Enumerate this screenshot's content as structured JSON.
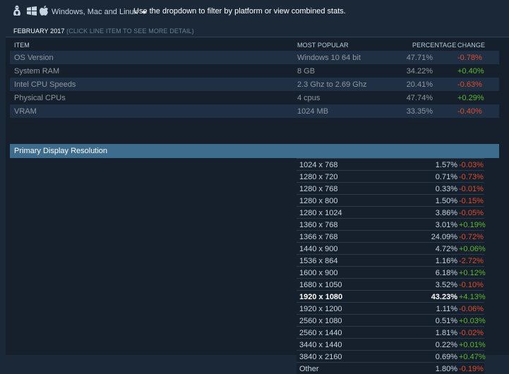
{
  "platform": {
    "icons": [
      "linux-icon",
      "windows-icon",
      "apple-icon"
    ],
    "selected": "Windows, Mac and Linux",
    "hint": "Use the dropdown to filter by platform or view combined stats."
  },
  "panel": {
    "title": "FEBRUARY 2017",
    "subtitle": "(CLICK LINE ITEM TO SEE MORE DETAIL)"
  },
  "columns": {
    "item": "ITEM",
    "popular": "MOST POPULAR",
    "percentage": "PERCENTAGE",
    "change": "CHANGE"
  },
  "rows": [
    {
      "item": "OS Version",
      "popular": "Windows 10 64 bit",
      "percentage": "47.71%",
      "change": "-0.78%",
      "trend": "neg"
    },
    {
      "item": "System RAM",
      "popular": "8 GB",
      "percentage": "34.22%",
      "change": "+0.40%",
      "trend": "pos"
    },
    {
      "item": "Intel CPU Speeds",
      "popular": "2.3 Ghz to 2.69 Ghz",
      "percentage": "20.41%",
      "change": "-0.63%",
      "trend": "neg"
    },
    {
      "item": "Physical CPUs",
      "popular": "4 cpus",
      "percentage": "47.74%",
      "change": "+0.29%",
      "trend": "pos"
    },
    {
      "item": "VRAM",
      "popular": "1024 MB",
      "percentage": "33.35%",
      "change": "-0.40%",
      "trend": "neg"
    }
  ],
  "section": {
    "label": "Primary Display Resolution",
    "items": [
      {
        "label": "1024 x 768",
        "percentage": "1.57%",
        "change": "-0.03%",
        "trend": "neg"
      },
      {
        "label": "1280 x 720",
        "percentage": "0.71%",
        "change": "-0.73%",
        "trend": "neg"
      },
      {
        "label": "1280 x 768",
        "percentage": "0.33%",
        "change": "-0.01%",
        "trend": "neg"
      },
      {
        "label": "1280 x 800",
        "percentage": "1.50%",
        "change": "-0.15%",
        "trend": "neg"
      },
      {
        "label": "1280 x 1024",
        "percentage": "3.86%",
        "change": "-0.05%",
        "trend": "neg"
      },
      {
        "label": "1360 x 768",
        "percentage": "3.01%",
        "change": "+0.19%",
        "trend": "pos"
      },
      {
        "label": "1366 x 768",
        "percentage": "24.09%",
        "change": "-0.72%",
        "trend": "neg"
      },
      {
        "label": "1440 x 900",
        "percentage": "4.72%",
        "change": "+0.06%",
        "trend": "pos"
      },
      {
        "label": "1536 x 864",
        "percentage": "1.16%",
        "change": "-2.72%",
        "trend": "neg"
      },
      {
        "label": "1600 x 900",
        "percentage": "6.18%",
        "change": "+0.12%",
        "trend": "pos"
      },
      {
        "label": "1680 x 1050",
        "percentage": "3.52%",
        "change": "-0.10%",
        "trend": "neg"
      },
      {
        "label": "1920 x 1080",
        "percentage": "43.23%",
        "change": "+4.13%",
        "trend": "pos",
        "bold": true
      },
      {
        "label": "1920 x 1200",
        "percentage": "1.11%",
        "change": "-0.06%",
        "trend": "neg"
      },
      {
        "label": "2560 x 1080",
        "percentage": "0.51%",
        "change": "+0.03%",
        "trend": "pos"
      },
      {
        "label": "2560 x 1440",
        "percentage": "1.81%",
        "change": "-0.02%",
        "trend": "neg"
      },
      {
        "label": "3440 x 1440",
        "percentage": "0.22%",
        "change": "+0.01%",
        "trend": "pos"
      },
      {
        "label": "3840 x 2160",
        "percentage": "0.69%",
        "change": "+0.47%",
        "trend": "pos"
      },
      {
        "label": "Other",
        "percentage": "1.80%",
        "change": "-0.19%",
        "trend": "neg"
      }
    ]
  },
  "colors": {
    "background": "#1b2838",
    "positive": "#5cb82e",
    "negative": "#e04b2b",
    "section": "#3d6c8d"
  }
}
